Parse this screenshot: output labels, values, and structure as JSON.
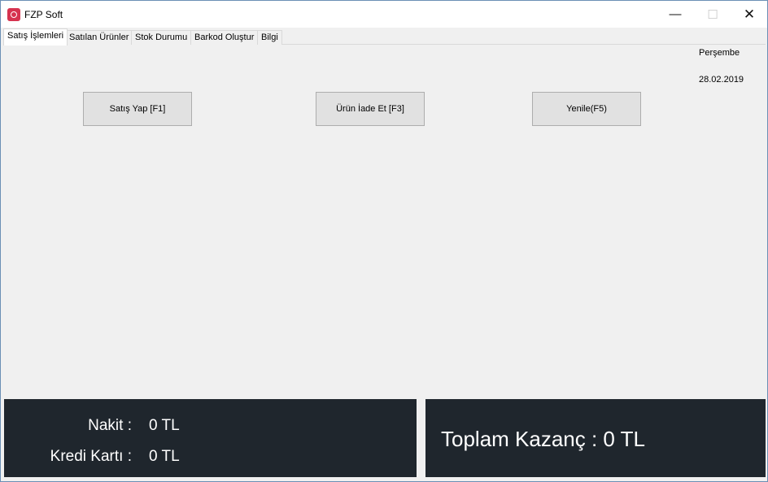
{
  "window": {
    "title": "FZP Soft",
    "icon": "app-logo-icon",
    "controls": {
      "minimize": "—",
      "maximize": "☐",
      "close": "✕"
    }
  },
  "tabs": [
    {
      "label": "Satış İşlemleri",
      "active": true
    },
    {
      "label": "Satılan Ürünler",
      "active": false
    },
    {
      "label": "Stok Durumu",
      "active": false
    },
    {
      "label": "Barkod Oluştur",
      "active": false
    },
    {
      "label": "Bilgi",
      "active": false
    }
  ],
  "info": {
    "day": "Perşembe",
    "date": "28.02.2019"
  },
  "buttons": {
    "sale": "Satış Yap [F1]",
    "return": "Ürün İade Et [F3]",
    "refresh": "Yenile(F5)"
  },
  "summary": {
    "cash_label": "Nakit :",
    "cash_value": "0 TL",
    "card_label": "Kredi Kartı :",
    "card_value": "0 TL",
    "total_text": "Toplam Kazanç : 0 TL"
  },
  "colors": {
    "panel_bg": "#1f262d",
    "panel_text": "#ffffff",
    "window_bg": "#f0f0f0"
  }
}
